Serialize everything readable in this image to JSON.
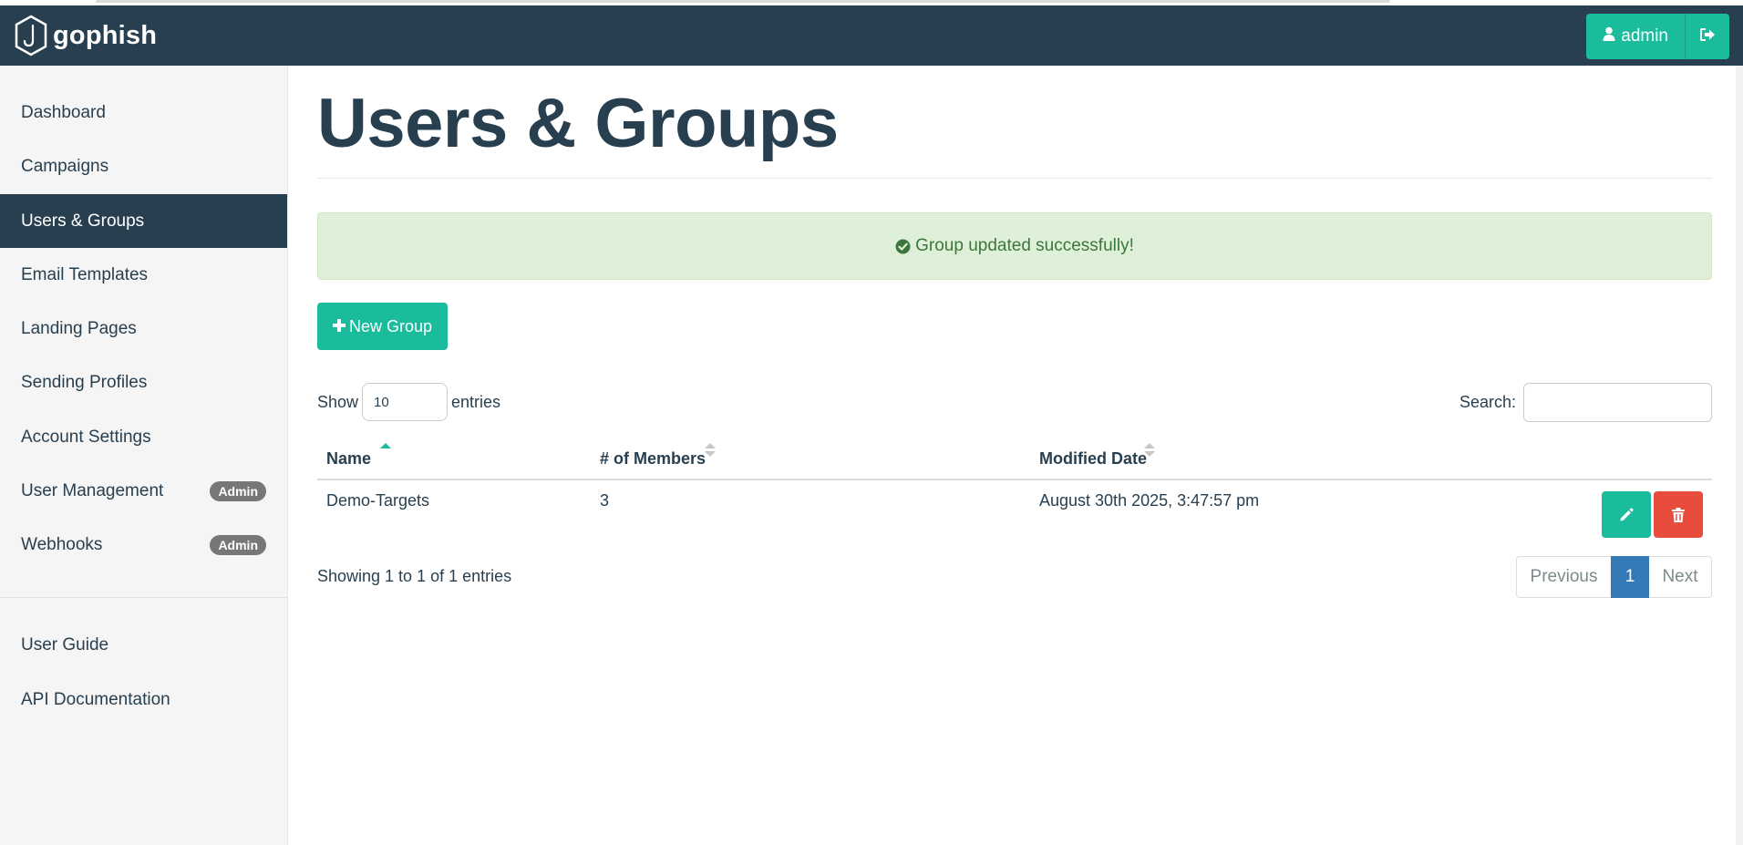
{
  "app": {
    "brand_name": "gophish",
    "user_label": "admin"
  },
  "sidebar": {
    "items": [
      {
        "label": "Dashboard",
        "badge": ""
      },
      {
        "label": "Campaigns",
        "badge": ""
      },
      {
        "label": "Users & Groups",
        "badge": "",
        "active": true
      },
      {
        "label": "Email Templates",
        "badge": ""
      },
      {
        "label": "Landing Pages",
        "badge": ""
      },
      {
        "label": "Sending Profiles",
        "badge": ""
      },
      {
        "label": "Account Settings",
        "badge": ""
      },
      {
        "label": "User Management",
        "badge": "Admin"
      },
      {
        "label": "Webhooks",
        "badge": "Admin"
      }
    ],
    "footer_items": [
      {
        "label": "User Guide"
      },
      {
        "label": "API Documentation"
      }
    ]
  },
  "main": {
    "title": "Users & Groups",
    "alert": "Group updated successfully!",
    "new_group_label": "New Group",
    "show_label": "Show",
    "entries_value": "10",
    "entries_label": "entries",
    "search_label": "Search:",
    "search_value": "",
    "table": {
      "headers": [
        "Name",
        "# of Members",
        "Modified Date"
      ],
      "rows": [
        {
          "name": "Demo-Targets",
          "members": "3",
          "modified": "August 30th 2025, 3:47:57 pm"
        }
      ]
    },
    "showing_text": "Showing 1 to 1 of 1 entries",
    "pagination": {
      "previous": "Previous",
      "current": "1",
      "next": "Next"
    }
  },
  "colors": {
    "navbar": "#283f50",
    "accent": "#1abc9c",
    "danger": "#e74c3c",
    "alert_bg": "#dff0d8",
    "pager_active": "#337ab7"
  }
}
